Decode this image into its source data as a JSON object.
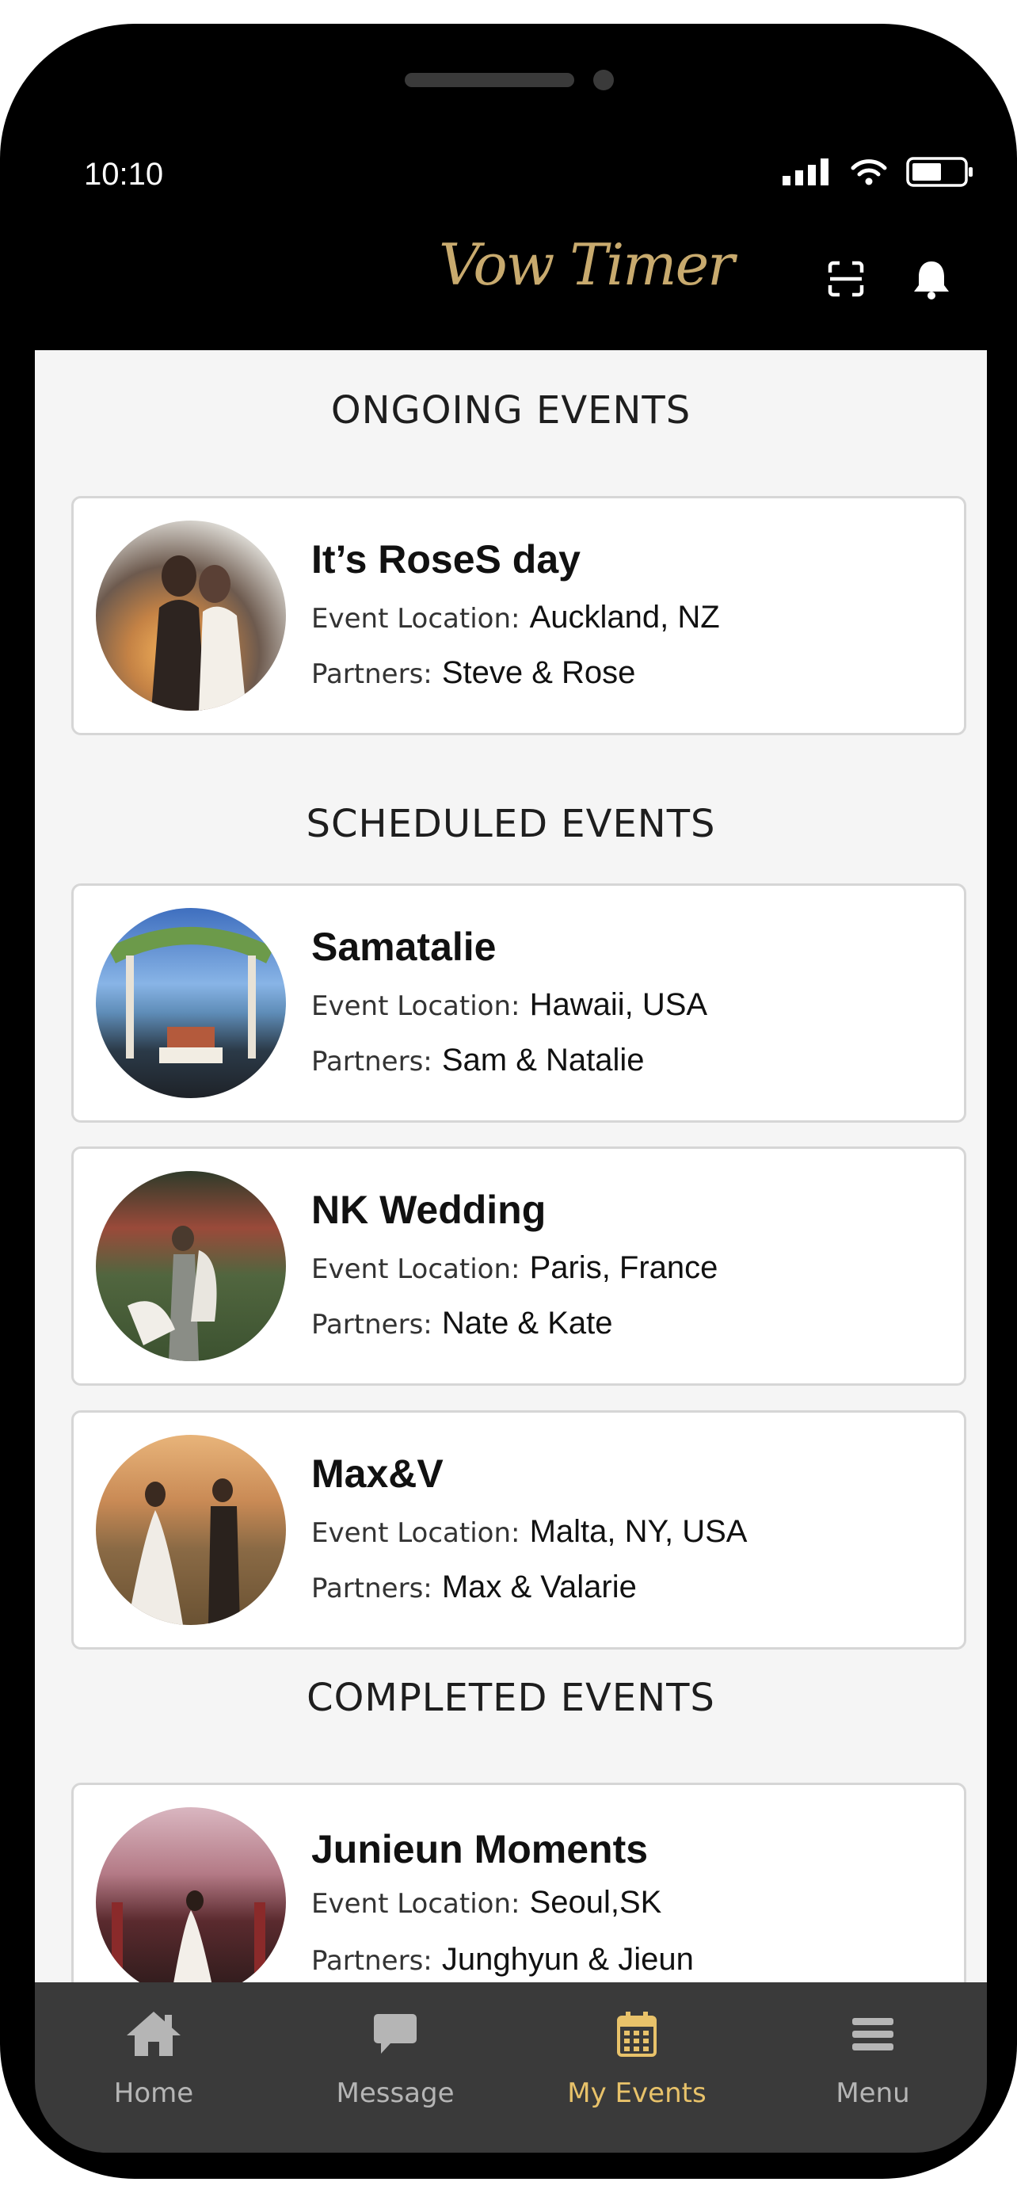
{
  "status_bar": {
    "time": "10:10"
  },
  "header": {
    "logo_text": "Vow Timer",
    "scan_icon": "scan-icon",
    "bell_icon": "bell-icon"
  },
  "sections": {
    "ongoing_title": "ONGOING EVENTS",
    "scheduled_title": "SCHEDULED EVENTS",
    "completed_title": "COMPLETED EVENTS"
  },
  "labels": {
    "location": "Event Location:",
    "partners": "Partners:"
  },
  "events": [
    {
      "name": "It’s RoseS day",
      "location": "Auckland, NZ",
      "partners": "Steve & Rose"
    },
    {
      "name": "Samatalie",
      "location": "Hawaii, USA",
      "partners": "Sam & Natalie"
    },
    {
      "name": "NK Wedding",
      "location": "Paris, France",
      "partners": "Nate & Kate"
    },
    {
      "name": "Max&V",
      "location": "Malta, NY, USA",
      "partners": "Max & Valarie"
    },
    {
      "name": "Junieun Moments",
      "location": "Seoul,SK",
      "partners": "Junghyun & Jieun"
    }
  ],
  "tabbar": [
    {
      "label": "Home",
      "icon": "home-icon",
      "active": false
    },
    {
      "label": "Message",
      "icon": "message-icon",
      "active": false
    },
    {
      "label": "My Events",
      "icon": "calendar-icon",
      "active": true
    },
    {
      "label": "Menu",
      "icon": "menu-icon",
      "active": false
    }
  ],
  "colors": {
    "accent": "#e8c26a",
    "logo": "#c8aa6e",
    "tabbar_bg": "#3a3a3a",
    "content_bg": "#f5f5f5"
  }
}
